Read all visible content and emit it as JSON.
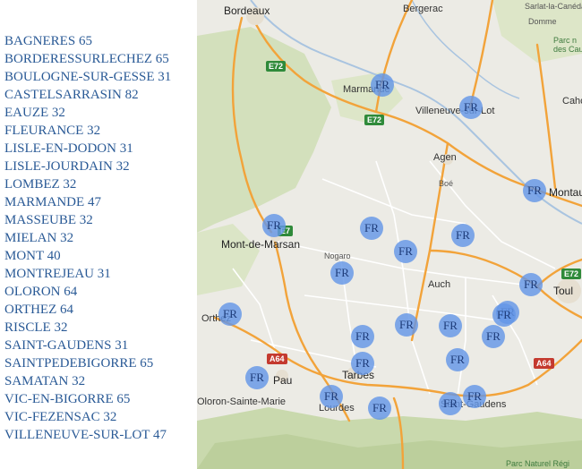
{
  "towns": [
    {
      "name": "BAGNERES",
      "dept": "65"
    },
    {
      "name": "BORDERESSURLECHEZ",
      "dept": "65"
    },
    {
      "name": "BOULOGNE-SUR-GESSE",
      "dept": "31"
    },
    {
      "name": "CASTELSARRASIN",
      "dept": "82"
    },
    {
      "name": "EAUZE",
      "dept": "32"
    },
    {
      "name": "FLEURANCE",
      "dept": "32"
    },
    {
      "name": "LISLE-EN-DODON",
      "dept": "31"
    },
    {
      "name": "LISLE-JOURDAIN",
      "dept": "32"
    },
    {
      "name": "LOMBEZ",
      "dept": "32"
    },
    {
      "name": "MARMANDE",
      "dept": "47"
    },
    {
      "name": "MASSEUBE",
      "dept": "32"
    },
    {
      "name": "MIELAN",
      "dept": "32"
    },
    {
      "name": "MONT",
      "dept": "40"
    },
    {
      "name": "MONTREJEAU",
      "dept": "31"
    },
    {
      "name": "OLORON",
      "dept": "64"
    },
    {
      "name": "ORTHEZ",
      "dept": "64"
    },
    {
      "name": "RISCLE",
      "dept": "32"
    },
    {
      "name": "SAINT-GAUDENS",
      "dept": "31"
    },
    {
      "name": "SAINTPEDEBIGORRE",
      "dept": "65"
    },
    {
      "name": "SAMATAN",
      "dept": "32"
    },
    {
      "name": "VIC-EN-BIGORRE",
      "dept": "65"
    },
    {
      "name": "VIC-FEZENSAC",
      "dept": "32"
    },
    {
      "name": "VILLENEUVE-SUR-LOT",
      "dept": "47"
    }
  ],
  "marker_label": "FR",
  "map": {
    "places": {
      "bordeaux": "Bordeaux",
      "bergerac": "Bergerac",
      "sarlat": "Sarlat-la-Canéda",
      "domme": "Domme",
      "marmande": "Marmande",
      "villeneuve": "Villeneuve-sur-Lot",
      "cahors": "Cahc",
      "agen": "Agen",
      "boe": "Boé",
      "montauban": "Montaub",
      "mont_de_marsan": "Mont-de-Marsan",
      "nogaro": "Nogaro",
      "auch": "Auch",
      "toulouse": "Toul",
      "orthez": "Orthez",
      "pau": "Pau",
      "tarbes": "Tarbes",
      "lourdes": "Lourdes",
      "oloron": "Oloron-Sainte-Marie",
      "saint_gaudens": "Saint-Gaudens"
    },
    "roads": {
      "e72a": "E72",
      "e72b": "E72",
      "e7": "E7",
      "e72c": "E72",
      "a64a": "A64",
      "a64b": "A64"
    },
    "parks": {
      "causses": "Parc n\ndes Cau",
      "pyrenees": "Parc Naturel Régi"
    }
  }
}
